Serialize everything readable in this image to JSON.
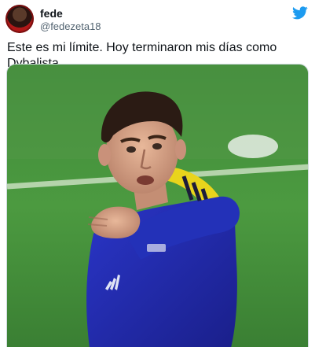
{
  "tweet": {
    "display_name": "fede",
    "handle": "@fedezeta18",
    "text": "Este es mi límite. Hoy terminaron mis días como Dybalista.",
    "icons": {
      "brand": "twitter-bird-icon"
    },
    "colors": {
      "brand": "#1d9bf0",
      "handle": "#536471",
      "text": "#0f1419"
    }
  }
}
